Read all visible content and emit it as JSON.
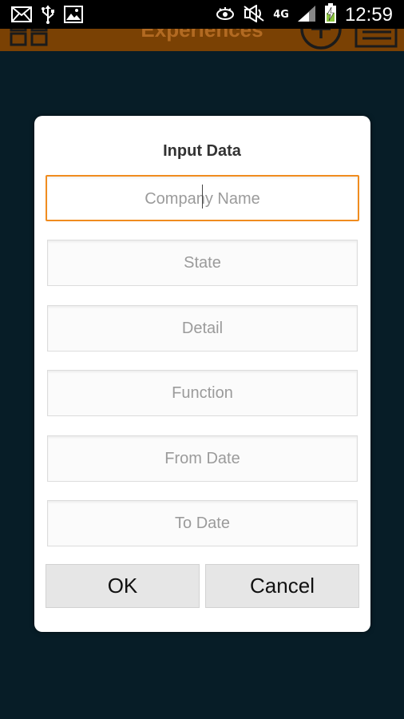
{
  "status_bar": {
    "time": "12:59",
    "network": "4G",
    "icons": [
      "email-icon",
      "usb-icon",
      "image-icon",
      "eye-icon",
      "mute-icon",
      "signal-icon",
      "battery-charging-icon"
    ]
  },
  "app_bar": {
    "title": "Experiences",
    "icons": [
      "grid-icon",
      "add-icon",
      "list-icon"
    ],
    "color": "#7a4104"
  },
  "dialog": {
    "title": "Input Data",
    "fields": [
      {
        "placeholder": "Company Name",
        "focused": true
      },
      {
        "placeholder": "State"
      },
      {
        "placeholder": "Detail"
      },
      {
        "placeholder": "Function"
      },
      {
        "placeholder": "From Date"
      },
      {
        "placeholder": "To Date"
      }
    ],
    "ok_label": "OK",
    "cancel_label": "Cancel",
    "accent_color": "#f08c1f"
  },
  "colors": {
    "background": "#071d27",
    "dialog_bg": "#ffffff"
  }
}
